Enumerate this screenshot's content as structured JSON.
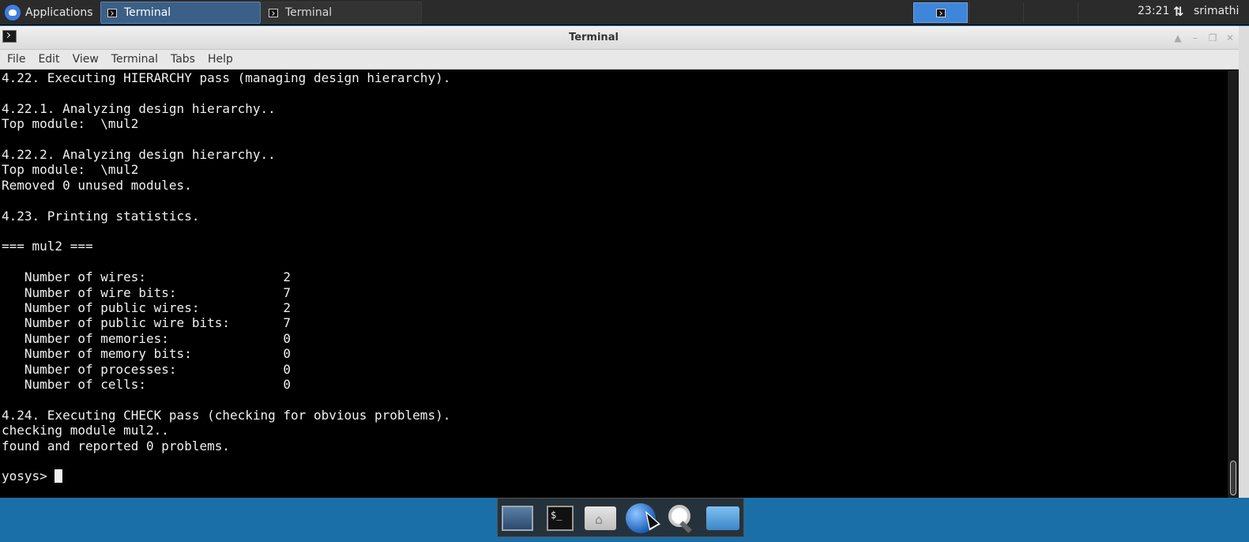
{
  "top_panel": {
    "applications_label": "Applications",
    "tasks": [
      {
        "label": "Terminal",
        "active": true
      },
      {
        "label": "Terminal",
        "active": false
      }
    ],
    "clock": "23:21",
    "user": "srimathi"
  },
  "window": {
    "title": "Terminal",
    "menu": [
      "File",
      "Edit",
      "View",
      "Terminal",
      "Tabs",
      "Help"
    ]
  },
  "terminal": {
    "lines": [
      "4.22. Executing HIERARCHY pass (managing design hierarchy).",
      "",
      "4.22.1. Analyzing design hierarchy..",
      "Top module:  \\mul2",
      "",
      "4.22.2. Analyzing design hierarchy..",
      "Top module:  \\mul2",
      "Removed 0 unused modules.",
      "",
      "4.23. Printing statistics.",
      "",
      "=== mul2 ===",
      "",
      "   Number of wires:                  2",
      "   Number of wire bits:              7",
      "   Number of public wires:           2",
      "   Number of public wire bits:       7",
      "   Number of memories:               0",
      "   Number of memory bits:            0",
      "   Number of processes:              0",
      "   Number of cells:                  0",
      "",
      "4.24. Executing CHECK pass (checking for obvious problems).",
      "checking module mul2..",
      "found and reported 0 problems.",
      ""
    ],
    "prompt": "yosys> "
  },
  "dock": {
    "items": [
      "desktop-icon",
      "terminal-icon",
      "home-folder-icon",
      "web-browser-icon",
      "search-icon",
      "folder-icon"
    ],
    "terminal_glyph": "$_"
  }
}
